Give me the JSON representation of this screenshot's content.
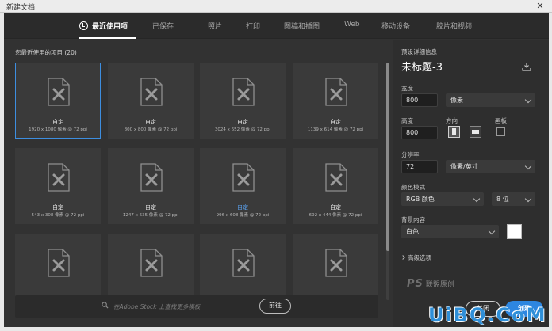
{
  "window": {
    "title": "新建文档",
    "close_glyph": "✕"
  },
  "tabs": [
    {
      "label": "最近使用项",
      "active": true,
      "icon": "clock-icon"
    },
    {
      "label": "已保存",
      "active": false
    },
    {
      "label": "照片",
      "active": false
    },
    {
      "label": "打印",
      "active": false
    },
    {
      "label": "图稿和插图",
      "active": false
    },
    {
      "label": "Web",
      "active": false
    },
    {
      "label": "移动设备",
      "active": false
    },
    {
      "label": "胶片和视频",
      "active": false
    }
  ],
  "recent": {
    "title": "您最近使用的项目 (20)",
    "items": [
      {
        "name": "自定",
        "size": "1920 x 1080 像素 @ 72 ppi",
        "selected": true
      },
      {
        "name": "自定",
        "size": "800 x 800 像素 @ 72 ppi"
      },
      {
        "name": "自定",
        "size": "3024 x 652 像素 @ 72 ppi"
      },
      {
        "name": "自定",
        "size": "1139 x 614 像素 @ 72 ppi"
      },
      {
        "name": "自定",
        "size": "543 x 308 像素 @ 72 ppi"
      },
      {
        "name": "自定",
        "size": "1247 x 635 像素 @ 72 ppi"
      },
      {
        "name": "自定",
        "size": "996 x 608 像素 @ 72 ppi",
        "highlight": true
      },
      {
        "name": "自定",
        "size": "692 x 444 像素 @ 72 ppi"
      },
      {
        "name": "",
        "size": ""
      },
      {
        "name": "",
        "size": ""
      },
      {
        "name": "",
        "size": ""
      },
      {
        "name": "",
        "size": ""
      }
    ]
  },
  "stock": {
    "placeholder": "在Adobe Stock 上查找更多模板",
    "go_label": "前往"
  },
  "preset": {
    "section_title": "预设详细信息",
    "doc_name": "未标题-3",
    "width_label": "宽度",
    "width_value": "800",
    "width_unit": "像素",
    "height_label": "高度",
    "height_value": "800",
    "orientation_label": "方向",
    "artboard_label": "画板",
    "resolution_label": "分辨率",
    "resolution_value": "72",
    "resolution_unit": "像素/英寸",
    "color_mode_label": "颜色模式",
    "color_mode_value": "RGB 颜色",
    "bit_depth_value": "8 位",
    "background_label": "背景内容",
    "background_value": "白色",
    "advanced_label": "高级选项"
  },
  "buttons": {
    "close": "关闭",
    "create": "创建"
  },
  "watermarks": {
    "psahz": "PS",
    "psahz_sub": "联盟原创",
    "uibq": "UiBQ.CoM"
  },
  "colors": {
    "accent": "#2d86e0",
    "selected_border": "#3d8ee0",
    "panel": "#323232"
  }
}
